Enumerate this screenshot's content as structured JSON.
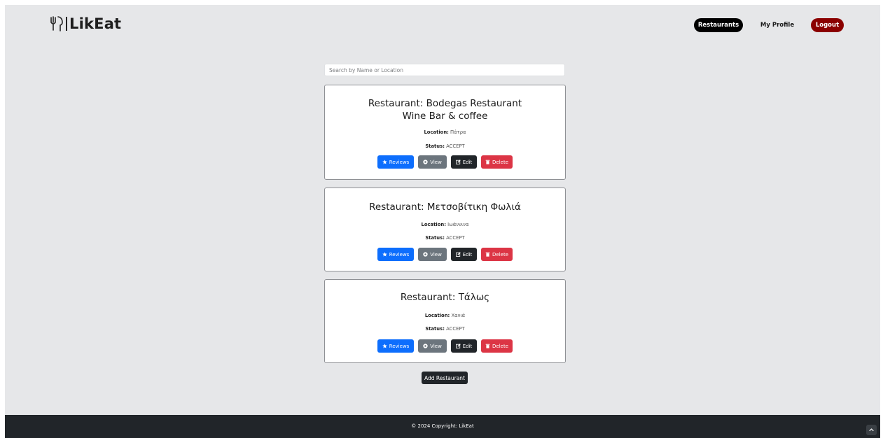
{
  "brand": {
    "name": "LikEat",
    "icon": "cutlery-hands-icon"
  },
  "nav": {
    "restaurants": "Restaurants",
    "my_profile": "My Profile",
    "logout": "Logout"
  },
  "search": {
    "placeholder": "Search by Name or Location",
    "value": ""
  },
  "labels": {
    "restaurant_prefix": "Restaurant:",
    "location": "Location:",
    "status": "Status:"
  },
  "buttons": {
    "reviews": "Reviews",
    "view": "View",
    "edit": "Edit",
    "delete": "Delete",
    "add_restaurant": "Add Restaurant"
  },
  "restaurants": [
    {
      "name": "Bodegas Restaurant Wine Bar & coffee",
      "location": "Πάτρα",
      "status": "ACCEPT"
    },
    {
      "name": "Μετσοβίτικη Φωλιά",
      "location": "Ιωάννινα",
      "status": "ACCEPT"
    },
    {
      "name": "Τάλως",
      "location": "Χανιά",
      "status": "ACCEPT"
    }
  ],
  "footer": {
    "copyright": "© 2024 Copyright: LikEat"
  },
  "colors": {
    "page_bg": "#e6e7e9",
    "footer_bg": "#212529",
    "logout_bg": "#8b0000",
    "reviews_bg": "#0d6efd",
    "view_bg": "#6c757d",
    "edit_bg": "#212529",
    "delete_bg": "#dc3545"
  }
}
